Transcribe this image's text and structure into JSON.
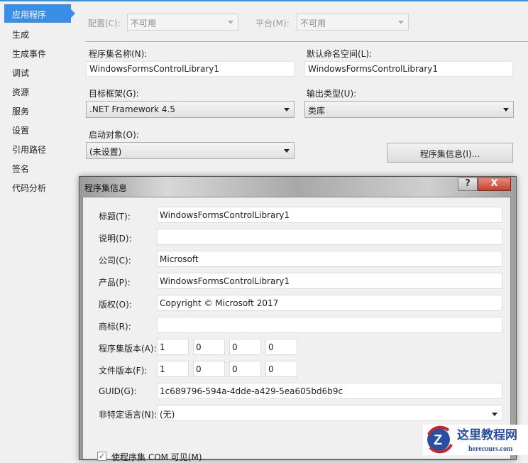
{
  "sidebar": {
    "items": [
      {
        "label": "应用程序"
      },
      {
        "label": "生成"
      },
      {
        "label": "生成事件"
      },
      {
        "label": "调试"
      },
      {
        "label": "资源"
      },
      {
        "label": "服务"
      },
      {
        "label": "设置"
      },
      {
        "label": "引用路径"
      },
      {
        "label": "签名"
      },
      {
        "label": "代码分析"
      }
    ]
  },
  "main": {
    "config_label": "配置(C):",
    "config_value": "不可用",
    "platform_label": "平台(M):",
    "platform_value": "不可用",
    "assembly_name_label": "程序集名称(N):",
    "assembly_name_value": "WindowsFormsControlLibrary1",
    "default_ns_label": "默认命名空间(L):",
    "default_ns_value": "WindowsFormsControlLibrary1",
    "target_framework_label": "目标框架(G):",
    "target_framework_value": ".NET Framework 4.5",
    "output_type_label": "输出类型(U):",
    "output_type_value": "类库",
    "startup_label": "启动对象(O):",
    "startup_value": "(未设置)",
    "assembly_info_button": "程序集信息(I)..."
  },
  "dialog": {
    "title": "程序集信息",
    "help": "?",
    "close": "X",
    "fields": [
      {
        "label": "标题(T):",
        "value": "WindowsFormsControlLibrary1"
      },
      {
        "label": "说明(D):",
        "value": ""
      },
      {
        "label": "公司(C):",
        "value": "Microsoft"
      },
      {
        "label": "产品(P):",
        "value": "WindowsFormsControlLibrary1"
      },
      {
        "label": "版权(O):",
        "value": "Copyright © Microsoft 2017"
      },
      {
        "label": "商标(R):",
        "value": ""
      }
    ],
    "assembly_version_label": "程序集版本(A):",
    "assembly_version": [
      "1",
      "0",
      "0",
      "0"
    ],
    "file_version_label": "文件版本(F):",
    "file_version": [
      "1",
      "0",
      "0",
      "0"
    ],
    "guid_label": "GUID(G):",
    "guid_value": "1c689796-594a-4dde-a429-5ea605bd6b9c",
    "neutral_lang_label": "非特定语言(N):",
    "neutral_lang_value": "(无)",
    "com_visible_label": "使程序集 COM 可见(M)",
    "com_visible_checked": true
  },
  "watermark": {
    "title": "这里教程网",
    "url": "herecours.com"
  }
}
